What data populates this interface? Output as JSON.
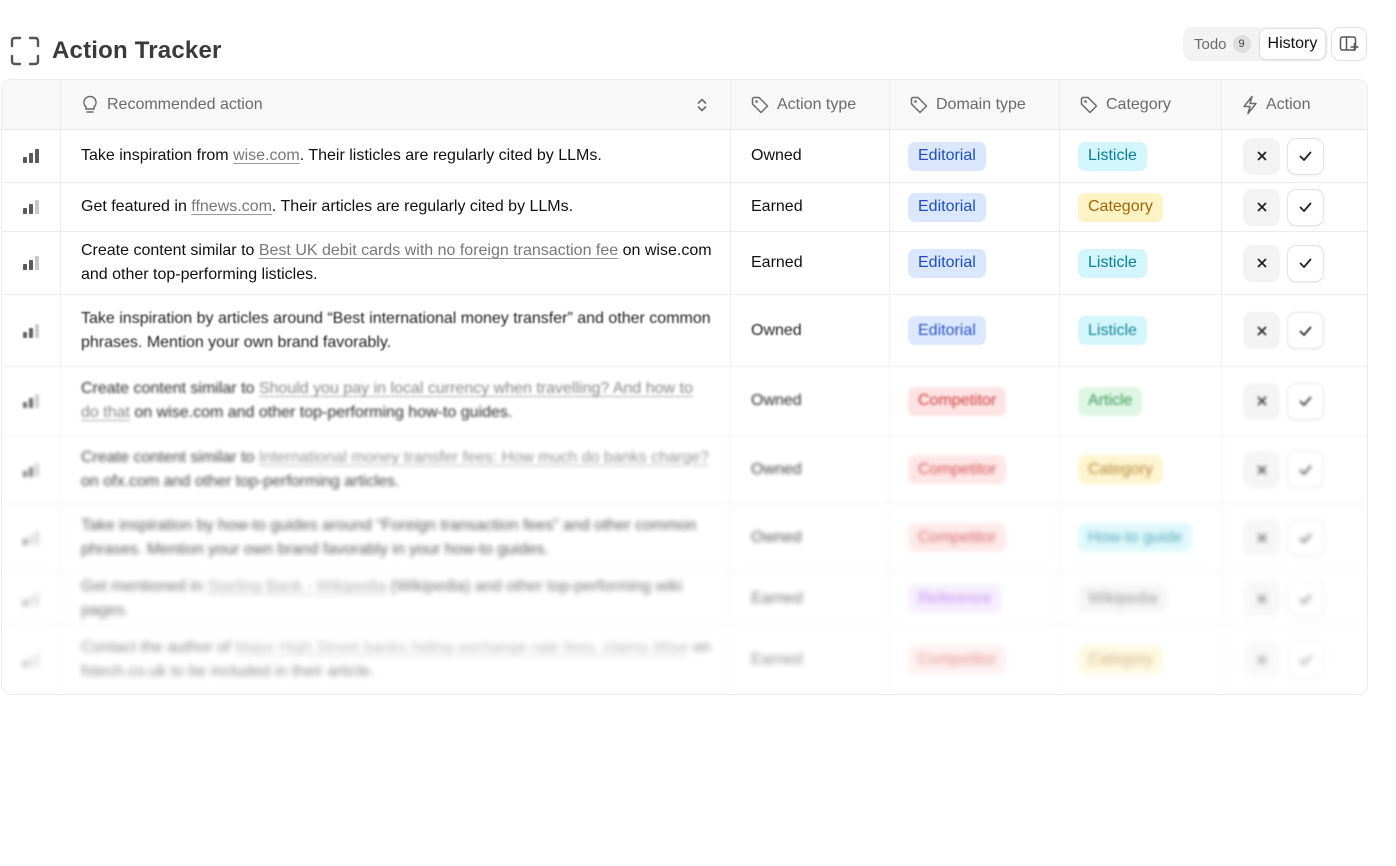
{
  "header": {
    "title": "Action Tracker",
    "icon": "scan-frame-icon",
    "tabs": {
      "todo_label": "Todo",
      "todo_count": "9",
      "history_label": "History"
    },
    "panel_icon": "panel-add-icon"
  },
  "table": {
    "columns": {
      "recommended_action": "Recommended action",
      "action_type": "Action type",
      "domain_type": "Domain type",
      "category": "Category",
      "action": "Action"
    },
    "rows": [
      {
        "priority": "high",
        "text_before": "Take inspiration from ",
        "link": "wise.com",
        "text_after": ". Their listicles are regularly cited by LLMs.",
        "action_type": "Owned",
        "domain_type": "Editorial",
        "category": "Listicle"
      },
      {
        "priority": "medium",
        "text_before": "Get featured in ",
        "link": "ffnews.com",
        "text_after": ". Their articles are regularly cited by LLMs.",
        "action_type": "Earned",
        "domain_type": "Editorial",
        "category": "Category"
      },
      {
        "priority": "medium",
        "text_before": "Create content similar to ",
        "link": "Best UK debit cards with no foreign transaction fee",
        "text_after": " on wise.com and other top-performing listicles.",
        "action_type": "Earned",
        "domain_type": "Editorial",
        "category": "Listicle"
      },
      {
        "priority": "medium",
        "text_before": "Take inspiration by articles around “Best international money transfer” and other common phrases. Mention your own brand favorably.",
        "link": "",
        "text_after": "",
        "action_type": "Owned",
        "domain_type": "Editorial",
        "category": "Listicle"
      },
      {
        "priority": "medium",
        "text_before": "Create content similar to ",
        "link": "Should you pay in local currency when travelling? And how to do that",
        "text_after": " on wise.com and other top-performing how-to guides.",
        "action_type": "Owned",
        "domain_type": "Competitor",
        "category": "Article"
      },
      {
        "priority": "medium",
        "text_before": "Create content similar to ",
        "link": "International money transfer fees: How much do banks charge?",
        "text_after": " on ofx.com and other top-performing articles.",
        "action_type": "Owned",
        "domain_type": "Competitor",
        "category": "Category"
      },
      {
        "priority": "low",
        "text_before": "Take inspiration by how-to guides around “Foreign transaction fees” and other common phrases. Mention your own brand favorably in your how-to guides.",
        "link": "",
        "text_after": "",
        "action_type": "Owned",
        "domain_type": "Competitor",
        "category": "How-to guide"
      },
      {
        "priority": "low",
        "text_before": "Get mentioned in ",
        "link": "Starling Bank - Wikipedia",
        "text_after": " (Wikipedia) and other top-performing wiki pages.",
        "action_type": "Earned",
        "domain_type": "Reference",
        "category": "Wikipedia"
      },
      {
        "priority": "low",
        "text_before": "Contact the author of ",
        "link": "Major High Street banks hiding exchange rate fees, claims Wise",
        "text_after": " on fstech.co.uk to be included in their article.",
        "action_type": "Earned",
        "domain_type": "Competitor",
        "category": "Category"
      }
    ]
  }
}
